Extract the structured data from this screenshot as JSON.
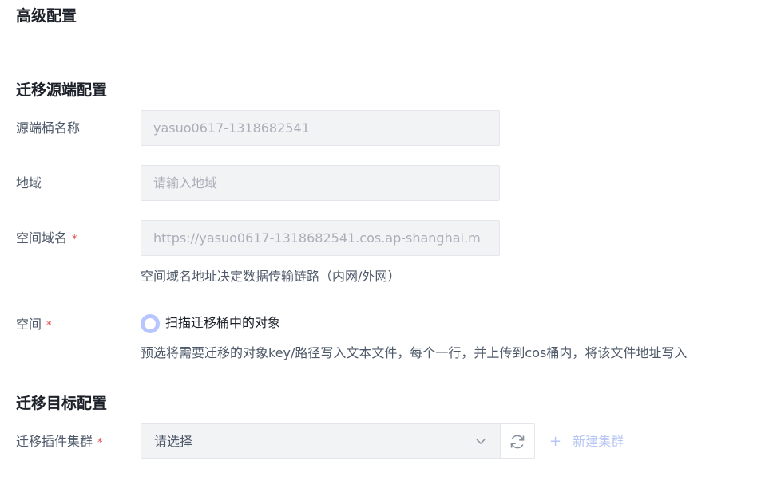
{
  "header": {
    "title": "高级配置"
  },
  "source": {
    "section_title": "迁移源端配置",
    "bucket": {
      "label": "源端桶名称",
      "value": "yasuo0617-1318682541"
    },
    "region": {
      "label": "地域",
      "placeholder": "请输入地域"
    },
    "domain": {
      "label": "空间域名",
      "required": "*",
      "value": "https://yasuo0617-1318682541.cos.ap-shanghai.m",
      "hint": "空间域名地址决定数据传输链路（内网/外网）"
    },
    "space": {
      "label": "空间",
      "required": "*",
      "option_label": "扫描迁移桶中的对象",
      "hint": "预选将需要迁移的对象key/路径写入文本文件，每个一行，并上传到cos桶内，将该文件地址写入"
    }
  },
  "target": {
    "section_title": "迁移目标配置",
    "cluster": {
      "label": "迁移插件集群",
      "required": "*",
      "select_placeholder": "请选择",
      "new_link_label": "新建集群"
    }
  },
  "icons": {
    "chevron": "chevron-down-icon",
    "refresh": "refresh-icon",
    "plus": "plus-icon"
  },
  "colors": {
    "accent_light": "#b8c6f5",
    "required": "#e54545",
    "input_bg": "#f2f3f5"
  }
}
